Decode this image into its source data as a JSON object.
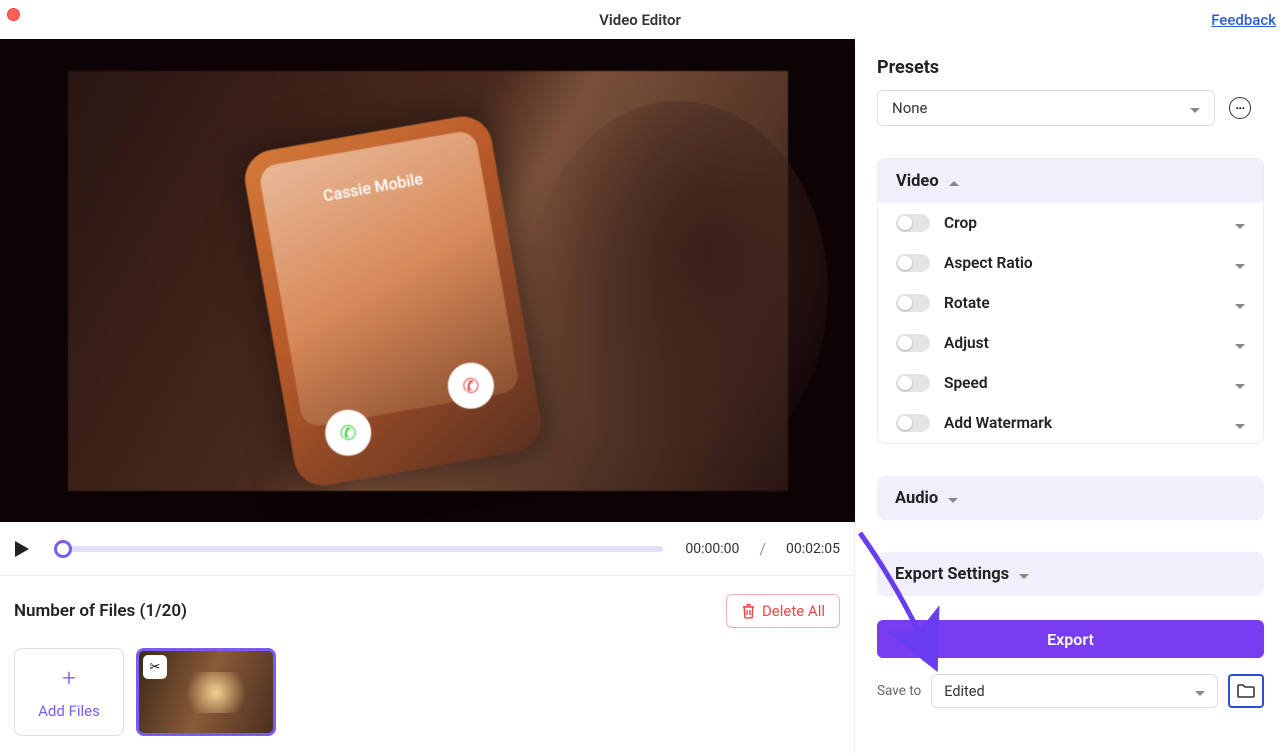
{
  "titlebar": {
    "app_title": "Video Editor",
    "feedback": "Feedback"
  },
  "player": {
    "current_time": "00:00:00",
    "duration": "00:02:05"
  },
  "preview": {
    "caller_name": "Cassie Mobile"
  },
  "files": {
    "count_label": "Number of Files (1/20)",
    "delete_all": "Delete All",
    "add_files": "Add Files"
  },
  "sidebar": {
    "presets_title": "Presets",
    "preset_value": "None",
    "video": {
      "title": "Video",
      "options": [
        "Crop",
        "Aspect Ratio",
        "Rotate",
        "Adjust",
        "Speed",
        "Add Watermark"
      ]
    },
    "audio": {
      "title": "Audio"
    },
    "export_settings": {
      "title": "Export Settings"
    },
    "export_btn": "Export",
    "save_to_label": "Save to",
    "save_to_value": "Edited"
  }
}
